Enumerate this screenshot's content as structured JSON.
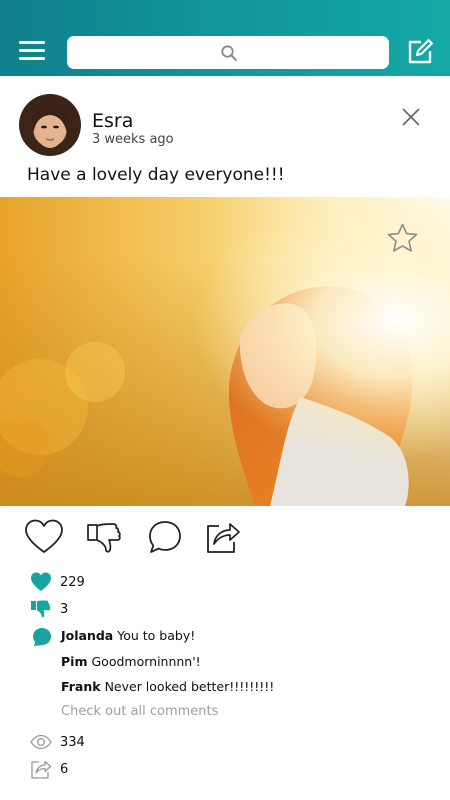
{
  "colors": {
    "accent": "#1aa3a3",
    "header_start": "#0f7f8c",
    "header_end": "#14a8a5"
  },
  "header": {
    "menu_icon": "hamburger-menu-icon",
    "search_placeholder": "",
    "search_icon": "search-icon",
    "compose_icon": "edit-icon"
  },
  "post": {
    "author": "Esra",
    "time": "3 weeks ago",
    "text": "Have a lovely day everyone!!!",
    "close_icon": "close-icon",
    "favorite_icon": "star-icon"
  },
  "actions": [
    "like",
    "dislike",
    "comment",
    "share"
  ],
  "stats": {
    "likes": "229",
    "dislikes": "3",
    "views": "334",
    "shares": "6"
  },
  "comments": [
    {
      "user": "Jolanda",
      "text": "You to baby!"
    },
    {
      "user": "Pim",
      "text": "Goodmorninnnn'!"
    },
    {
      "user": "Frank",
      "text": "Never looked better!!!!!!!!!"
    }
  ],
  "all_comments_label": "Check out all comments"
}
